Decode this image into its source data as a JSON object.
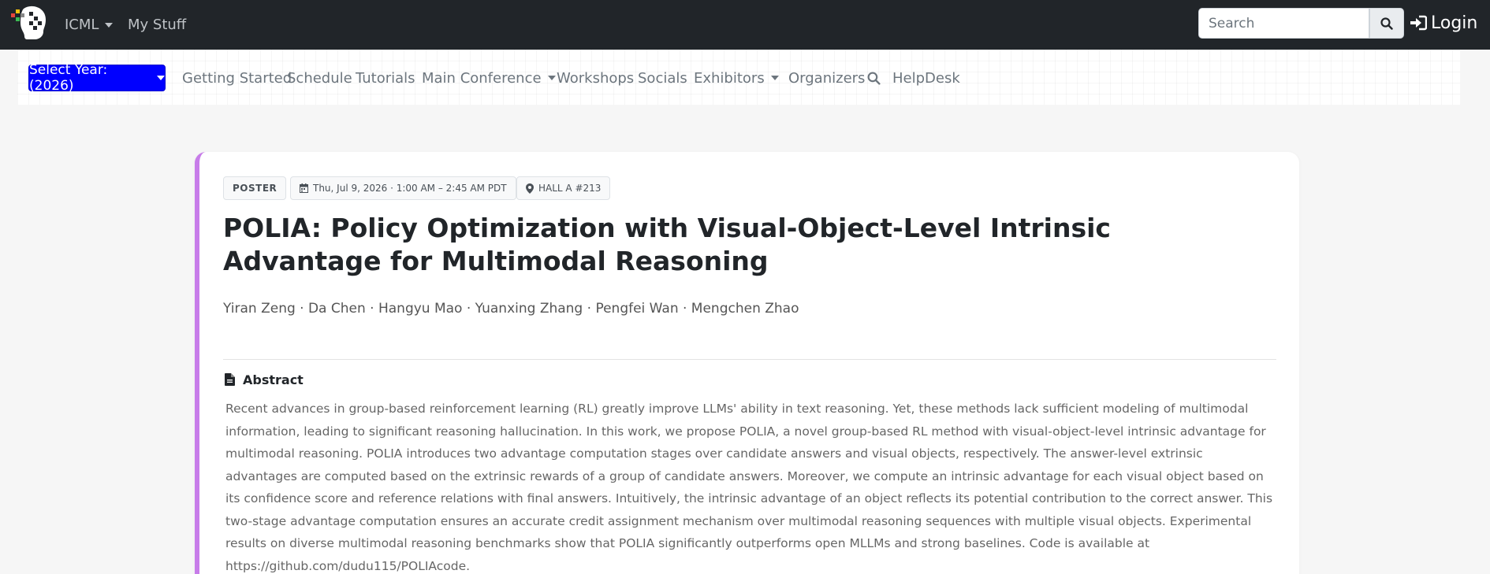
{
  "topbar": {
    "conference_menu": "ICML",
    "my_stuff": "My Stuff",
    "search_placeholder": "Search",
    "login": "Login"
  },
  "subnav": {
    "year_select": "Select Year: (2026)",
    "items": [
      {
        "label": "Getting Started",
        "dropdown": false
      },
      {
        "label": "Schedule",
        "dropdown": false
      },
      {
        "label": "Tutorials",
        "dropdown": false
      },
      {
        "label": "Main Conference",
        "dropdown": true
      },
      {
        "label": "Workshops",
        "dropdown": false
      },
      {
        "label": "Socials",
        "dropdown": false
      },
      {
        "label": "Exhibitors",
        "dropdown": true
      },
      {
        "label": "Organizers",
        "dropdown": false
      },
      {
        "label": "HelpDesk",
        "dropdown": false
      }
    ]
  },
  "paper": {
    "type_tag": "POSTER",
    "datetime": "Thu, Jul 9, 2026 · 1:00 AM – 2:45 AM PDT",
    "location": "HALL A #213",
    "title": "POLIA: Policy Optimization with Visual-Object-Level Intrinsic Advantage for Multimodal Reasoning",
    "authors": "Yiran Zeng · Da Chen · Hangyu Mao · Yuanxing Zhang · Pengfei Wan · Mengchen Zhao",
    "abstract_heading": "Abstract",
    "abstract": "Recent advances in group-based reinforcement learning (RL) greatly improve LLMs' ability in text reasoning. Yet, these methods lack sufficient modeling of multimodal information, leading to significant reasoning hallucination. In this work, we propose POLIA, a novel group-based RL method with visual-object-level intrinsic advantage for multimodal reasoning. POLIA introduces two advantage computation stages over candidate answers and visual objects, respectively. The answer-level extrinsic advantages are computed based on the extrinsic rewards of a group of candidate answers. Moreover, we compute an intrinsic advantage for each visual object based on its confidence score and reference relations with final answers. Intuitively, the intrinsic advantage of an object reflects its potential contribution to the correct answer. This two-stage advantage computation ensures an accurate credit assignment mechanism over multimodal reasoning sequences with multiple visual objects. Experimental results on diverse multimodal reasoning benchmarks show that POLIA significantly outperforms open MLLMs and strong baselines. Code is available at https://github.com/dudu115/POLIAcode."
  },
  "colors": {
    "topbar": "#212529",
    "year_button": "#0000ff",
    "card_accent": "#c77ce9"
  }
}
